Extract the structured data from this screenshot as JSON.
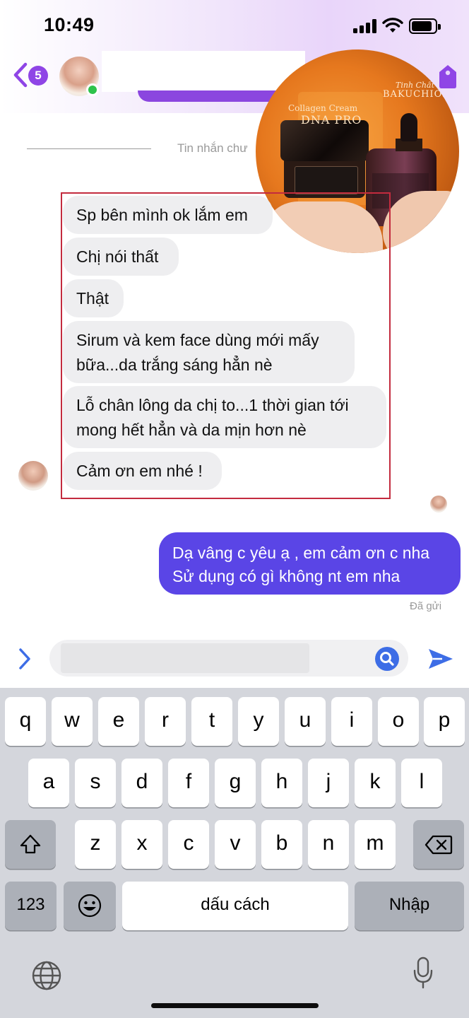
{
  "status_bar": {
    "time": "10:49",
    "signal_icon": "cellular-signal-icon",
    "wifi_icon": "wifi-icon",
    "battery_icon": "battery-icon"
  },
  "header": {
    "back_badge_count": "5",
    "avatar_icon": "contact-avatar",
    "online": true,
    "tag_icon": "tag-icon"
  },
  "product_photo": {
    "text_line1": "Collagen Cream",
    "text_line2": "DNA PRO",
    "text_line3": "Tinh Chất",
    "text_line4": "BAKUCHIOL"
  },
  "chat": {
    "separator_text": "Tin nhắn chư",
    "incoming": [
      "Sp bên mình ok lắm em",
      "Chị nói thất",
      "Thật",
      "Sirum và kem face dùng mới mấy bữa...da trắng sáng hẳn nè",
      "Lỗ chân lông da chị to...1 thời gian tới mong hết hẳn và da mịn hơn nè",
      "Cảm ơn em nhé !"
    ],
    "outgoing": [
      "Dạ vâng c yêu ạ , em cảm ơn c nha Sử dụng có gì không nt em nha"
    ],
    "sent_status": "Đã gửi"
  },
  "composer": {
    "expand_icon": "chevron-right-icon",
    "search_icon": "search-icon",
    "send_icon": "send-icon"
  },
  "keyboard": {
    "row1": [
      "q",
      "w",
      "e",
      "r",
      "t",
      "y",
      "u",
      "i",
      "o",
      "p"
    ],
    "row2": [
      "a",
      "s",
      "d",
      "f",
      "g",
      "h",
      "j",
      "k",
      "l"
    ],
    "row3": [
      "z",
      "x",
      "c",
      "v",
      "b",
      "n",
      "m"
    ],
    "numbers_key": "123",
    "space_key": "dấu cách",
    "return_key": "Nhập",
    "shift_icon": "shift-icon",
    "delete_icon": "delete-icon",
    "emoji_icon": "emoji-icon",
    "globe_icon": "globe-icon",
    "mic_icon": "microphone-icon"
  },
  "colors": {
    "accent_purple": "#8f45e6",
    "outgoing_bubble": "#5a45e6",
    "incoming_bubble": "#eeeef0",
    "highlight_border": "#c32b3e",
    "online_green": "#2ec34b"
  }
}
